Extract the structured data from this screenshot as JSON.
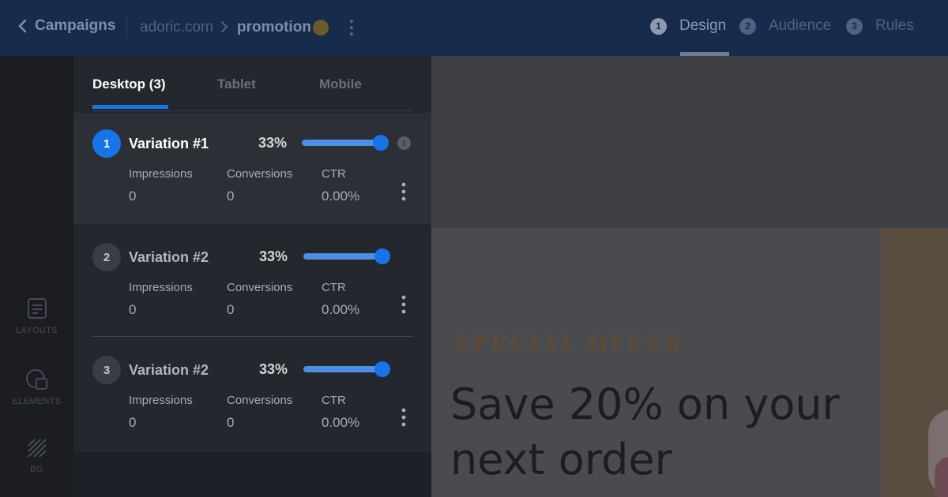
{
  "topbar": {
    "back_label": "Campaigns",
    "domain": "adoric.com",
    "campaign_name": "promotion",
    "steps": [
      {
        "num": "1",
        "label": "Design",
        "active": true
      },
      {
        "num": "2",
        "label": "Audience",
        "active": false
      },
      {
        "num": "3",
        "label": "Rules",
        "active": false
      }
    ]
  },
  "rail": {
    "items": [
      {
        "label": "LAYOUTS",
        "icon": "layouts-icon"
      },
      {
        "label": "ELEMENTS",
        "icon": "elements-icon"
      },
      {
        "label": "BG",
        "icon": "background-icon"
      }
    ]
  },
  "panel": {
    "tabs": [
      {
        "label": "Desktop (3)",
        "active": true
      },
      {
        "label": "Tablet",
        "active": false
      },
      {
        "label": "Mobile",
        "active": false
      }
    ],
    "stat_labels": {
      "impressions": "Impressions",
      "conversions": "Conversions",
      "ctr": "CTR"
    },
    "variations": [
      {
        "num": "1",
        "name": "Variation #1",
        "percent": "33%",
        "split_fraction": 0.33,
        "impressions": "0",
        "conversions": "0",
        "ctr": "0.00%",
        "selected": true
      },
      {
        "num": "2",
        "name": "Variation #2",
        "percent": "33%",
        "split_fraction": 0.33,
        "impressions": "0",
        "conversions": "0",
        "ctr": "0.00%",
        "selected": false
      },
      {
        "num": "3",
        "name": "Variation #2",
        "percent": "33%",
        "split_fraction": 0.33,
        "impressions": "0",
        "conversions": "0",
        "ctr": "0.00%",
        "selected": false
      }
    ]
  },
  "canvas": {
    "eyebrow": "SPECIAL OFFER",
    "headline": "Save 20% on your next order"
  },
  "colors": {
    "accent": "#1773e8",
    "topbar": "#172b4c",
    "panel": "#25272e",
    "offer_text": "#5e4a35"
  }
}
